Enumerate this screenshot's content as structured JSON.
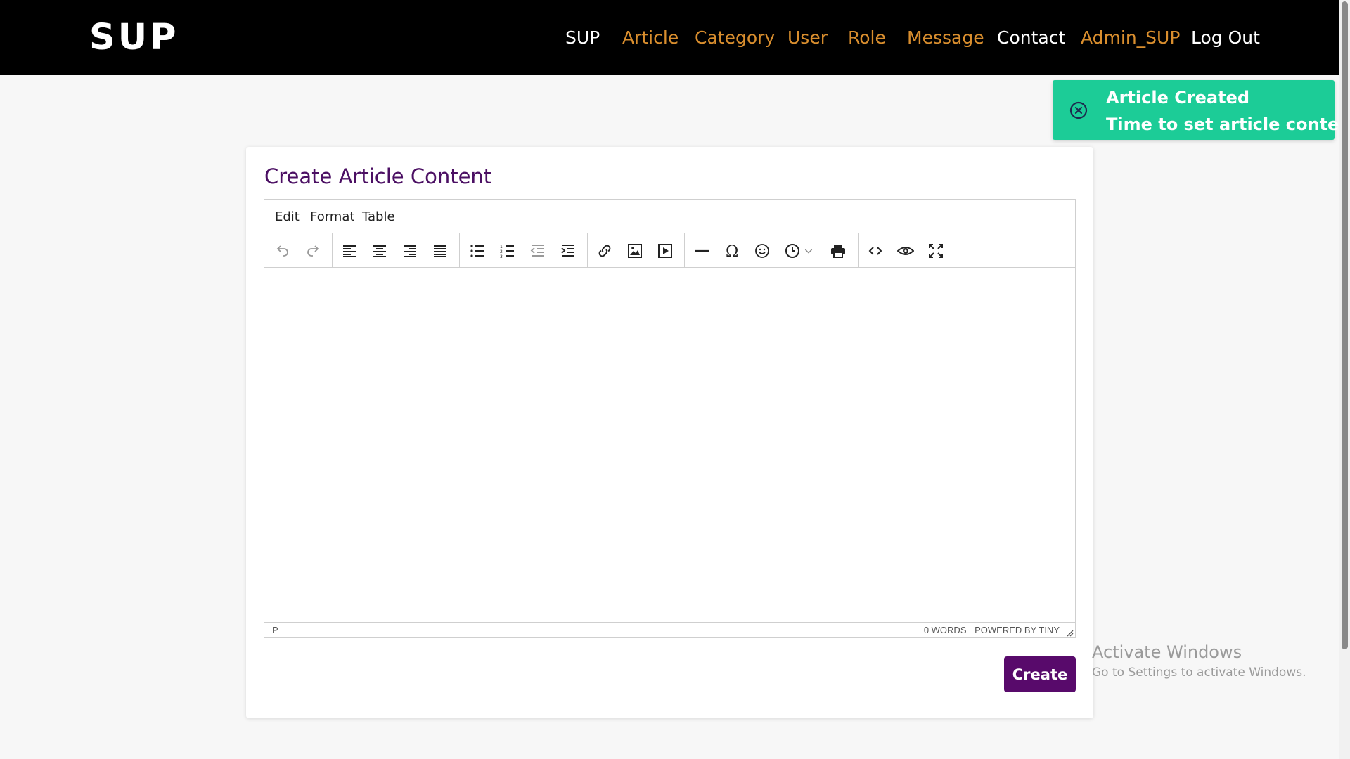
{
  "navbar": {
    "brand": "SUP",
    "links": [
      {
        "label": "SUP",
        "color": "#ffffff"
      },
      {
        "label": "Article",
        "color": "#d98e2e"
      },
      {
        "label": "Category",
        "color": "#d98e2e"
      },
      {
        "label": "User",
        "color": "#d98e2e"
      },
      {
        "label": "Role",
        "color": "#d98e2e"
      },
      {
        "label": "Message",
        "color": "#d98e2e"
      },
      {
        "label": "Contact",
        "color": "#ffffff"
      },
      {
        "label": "Admin_SUP",
        "color": "#d98e2e"
      },
      {
        "label": "Log Out",
        "color": "#ffffff"
      }
    ]
  },
  "toast": {
    "title": "Article Created",
    "message": "Time to set article content",
    "icon": "close-circle-icon",
    "color": "#1ccc97"
  },
  "card": {
    "title": "Create Article Content"
  },
  "editor": {
    "menu": [
      "Edit",
      "Format",
      "Table"
    ],
    "toolbar_icons": [
      "undo-icon",
      "redo-icon",
      "align-left-icon",
      "align-center-icon",
      "align-right-icon",
      "align-justify-icon",
      "bullet-list-icon",
      "numbered-list-icon",
      "outdent-icon",
      "indent-icon",
      "link-icon",
      "image-icon",
      "media-icon",
      "horizontal-line-icon",
      "special-character-icon",
      "emoticon-icon",
      "datetime-icon",
      "print-icon",
      "source-code-icon",
      "preview-icon",
      "fullscreen-icon"
    ],
    "status_path": "P",
    "word_count": "0 WORDS",
    "powered_by": "POWERED BY TINY"
  },
  "create_button": {
    "label": "Create",
    "color": "#580a6b"
  },
  "watermark": {
    "title": "Activate Windows",
    "subtitle": "Go to Settings to activate Windows."
  }
}
